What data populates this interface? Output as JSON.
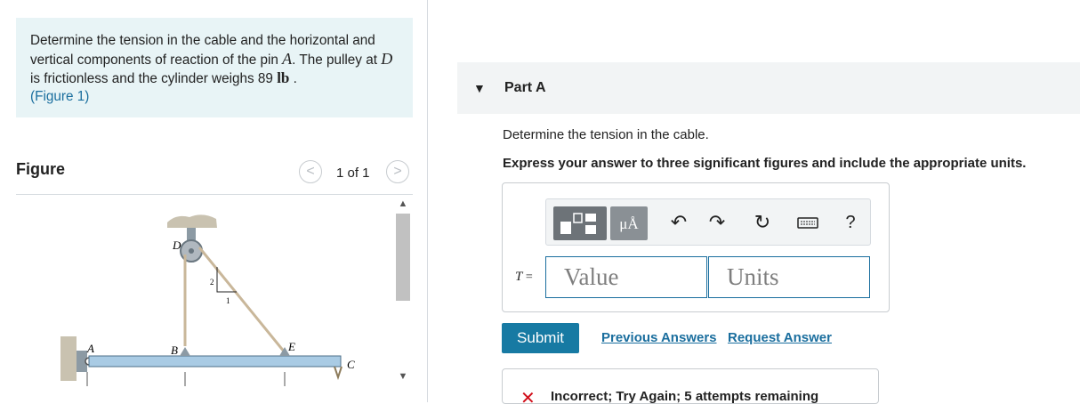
{
  "problem": {
    "text_1": "Determine the tension in the cable and the horizontal and vertical components of reaction of the pin ",
    "var_a": "A",
    "text_2": ". The pulley at ",
    "var_d": "D",
    "text_3": " is frictionless and the cylinder weighs 89 ",
    "unit": "lb",
    "text_4": " .",
    "figure_link": "(Figure 1)"
  },
  "figure_panel": {
    "heading": "Figure",
    "page_counter": "1 of 1",
    "prev_glyph": "<",
    "next_glyph": ">",
    "labels": {
      "a": "A",
      "b": "B",
      "c": "C",
      "d": "D",
      "e": "E",
      "slope_rise": "2",
      "slope_run": "1"
    }
  },
  "part": {
    "title": "Part A",
    "question": "Determine the tension in the cable.",
    "instruction": "Express your answer to three significant figures and include the appropriate units."
  },
  "answer": {
    "variable": "T",
    "equals": " =",
    "value_placeholder": "Value",
    "units_placeholder": "Units",
    "units_button_label": "μÅ",
    "help_label": "?"
  },
  "actions": {
    "submit": "Submit",
    "previous_answers": "Previous Answers",
    "request_answer": "Request Answer"
  },
  "feedback": {
    "icon": "✕",
    "text": "Incorrect; Try Again; 5 attempts remaining"
  },
  "colors": {
    "accent": "#177aa3",
    "link": "#1a6e9e",
    "problem_bg": "#e8f4f6",
    "error": "#d10e1a"
  }
}
